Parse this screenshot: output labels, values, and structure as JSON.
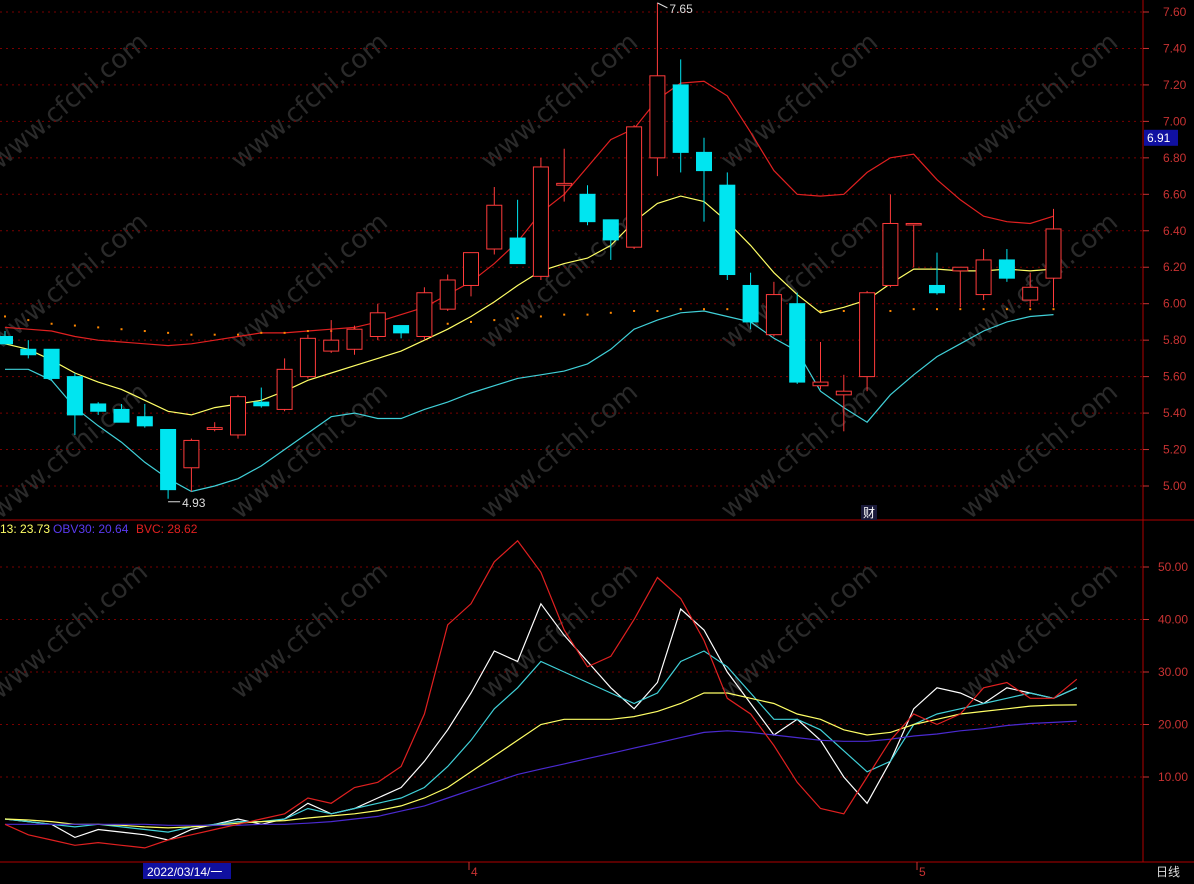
{
  "colors": {
    "background": "#000000",
    "frame": "#b00000",
    "grid": "#7a0000",
    "axis_text": "#c83232",
    "up": "#ff3b3b",
    "down": "#00e5f0",
    "ma_short": "#ffff66",
    "band_upper": "#e02020",
    "band_lower": "#40d0d8",
    "obv_white": "#ffffff",
    "obv_cyan": "#40d0d8",
    "obv_yellow": "#ffff66",
    "obv_blue": "#4a2ad0",
    "bvc_red": "#e02020",
    "price_tag_bg": "#1010a0",
    "date_tag_bg": "#1010a0"
  },
  "watermark": "www.cfchi.com",
  "chart_data": [
    {
      "type": "candlestick",
      "title": "",
      "ylim": [
        4.82,
        7.72
      ],
      "yticks": [
        "7.60",
        "7.40",
        "7.20",
        "7.00",
        "6.80",
        "6.60",
        "6.40",
        "6.20",
        "6.00",
        "5.80",
        "5.60",
        "5.40",
        "5.20",
        "5.00"
      ],
      "current_price_tag": "6.91",
      "high_label": "7.65",
      "low_label": "4.93",
      "event_marker": "财",
      "candles": [
        {
          "o": 5.82,
          "h": 5.85,
          "l": 5.78,
          "c": 5.78
        },
        {
          "o": 5.75,
          "h": 5.8,
          "l": 5.7,
          "c": 5.72
        },
        {
          "o": 5.75,
          "h": 5.75,
          "l": 5.58,
          "c": 5.59
        },
        {
          "o": 5.6,
          "h": 5.62,
          "l": 5.28,
          "c": 5.39
        },
        {
          "o": 5.45,
          "h": 5.46,
          "l": 5.39,
          "c": 5.41
        },
        {
          "o": 5.42,
          "h": 5.45,
          "l": 5.38,
          "c": 5.35
        },
        {
          "o": 5.38,
          "h": 5.45,
          "l": 5.32,
          "c": 5.33
        },
        {
          "o": 5.31,
          "h": 5.31,
          "l": 4.93,
          "c": 4.98
        },
        {
          "o": 5.1,
          "h": 5.26,
          "l": 4.97,
          "c": 5.25
        },
        {
          "o": 5.31,
          "h": 5.35,
          "l": 5.3,
          "c": 5.32
        },
        {
          "o": 5.28,
          "h": 5.5,
          "l": 5.26,
          "c": 5.49
        },
        {
          "o": 5.46,
          "h": 5.54,
          "l": 5.43,
          "c": 5.44
        },
        {
          "o": 5.42,
          "h": 5.7,
          "l": 5.41,
          "c": 5.64
        },
        {
          "o": 5.6,
          "h": 5.83,
          "l": 5.59,
          "c": 5.81
        },
        {
          "o": 5.74,
          "h": 5.91,
          "l": 5.73,
          "c": 5.8
        },
        {
          "o": 5.75,
          "h": 5.88,
          "l": 5.72,
          "c": 5.86
        },
        {
          "o": 5.82,
          "h": 6.0,
          "l": 5.8,
          "c": 5.95
        },
        {
          "o": 5.88,
          "h": 5.88,
          "l": 5.81,
          "c": 5.84
        },
        {
          "o": 5.82,
          "h": 6.09,
          "l": 5.8,
          "c": 6.06
        },
        {
          "o": 5.97,
          "h": 6.16,
          "l": 5.96,
          "c": 6.13
        },
        {
          "o": 6.1,
          "h": 6.23,
          "l": 6.04,
          "c": 6.28
        },
        {
          "o": 6.3,
          "h": 6.64,
          "l": 6.27,
          "c": 6.54
        },
        {
          "o": 6.36,
          "h": 6.57,
          "l": 6.22,
          "c": 6.22
        },
        {
          "o": 6.15,
          "h": 6.8,
          "l": 6.13,
          "c": 6.75
        },
        {
          "o": 6.65,
          "h": 6.85,
          "l": 6.56,
          "c": 6.66
        },
        {
          "o": 6.6,
          "h": 6.65,
          "l": 6.43,
          "c": 6.45
        },
        {
          "o": 6.46,
          "h": 6.46,
          "l": 6.24,
          "c": 6.35
        },
        {
          "o": 6.31,
          "h": 6.98,
          "l": 6.3,
          "c": 6.97
        },
        {
          "o": 6.8,
          "h": 7.65,
          "l": 6.7,
          "c": 7.25
        },
        {
          "o": 7.2,
          "h": 7.34,
          "l": 6.72,
          "c": 6.83
        },
        {
          "o": 6.83,
          "h": 6.91,
          "l": 6.45,
          "c": 6.73
        },
        {
          "o": 6.65,
          "h": 6.72,
          "l": 6.13,
          "c": 6.16
        },
        {
          "o": 6.1,
          "h": 6.17,
          "l": 5.86,
          "c": 5.9
        },
        {
          "o": 5.83,
          "h": 6.12,
          "l": 5.82,
          "c": 6.05
        },
        {
          "o": 6.0,
          "h": 6.06,
          "l": 5.56,
          "c": 5.57
        },
        {
          "o": 5.55,
          "h": 5.79,
          "l": 5.53,
          "c": 5.57
        },
        {
          "o": 5.5,
          "h": 5.61,
          "l": 5.3,
          "c": 5.52
        },
        {
          "o": 5.6,
          "h": 6.07,
          "l": 5.52,
          "c": 6.06
        },
        {
          "o": 6.1,
          "h": 6.6,
          "l": 6.09,
          "c": 6.44
        },
        {
          "o": 6.44,
          "h": 6.43,
          "l": 6.2,
          "c": 6.44
        },
        {
          "o": 6.1,
          "h": 6.28,
          "l": 6.05,
          "c": 6.06
        },
        {
          "o": 6.18,
          "h": 6.19,
          "l": 5.98,
          "c": 6.2
        },
        {
          "o": 6.05,
          "h": 6.3,
          "l": 6.02,
          "c": 6.24
        },
        {
          "o": 6.24,
          "h": 6.3,
          "l": 6.12,
          "c": 6.14
        },
        {
          "o": 6.02,
          "h": 6.17,
          "l": 5.98,
          "c": 6.09
        },
        {
          "o": 6.14,
          "h": 6.52,
          "l": 5.98,
          "c": 6.41
        }
      ],
      "series": [
        {
          "values": [
            5.87,
            5.86,
            5.85,
            5.82,
            5.8,
            5.79,
            5.78,
            5.77,
            5.78,
            5.8,
            5.82,
            5.84,
            5.84,
            5.85,
            5.86,
            5.87,
            5.9,
            5.94,
            5.98,
            6.05,
            6.12,
            6.22,
            6.34,
            6.5,
            6.6,
            6.75,
            6.9,
            6.96,
            7.12,
            7.21,
            7.22,
            7.14,
            6.94,
            6.73,
            6.6,
            6.59,
            6.6,
            6.72,
            6.8,
            6.82,
            6.68,
            6.57,
            6.48,
            6.45,
            6.44,
            6.48
          ]
        },
        {
          "values": [
            5.78,
            5.75,
            5.69,
            5.62,
            5.57,
            5.53,
            5.47,
            5.41,
            5.39,
            5.43,
            5.45,
            5.47,
            5.52,
            5.58,
            5.62,
            5.66,
            5.7,
            5.74,
            5.8,
            5.86,
            5.93,
            6.01,
            6.1,
            6.18,
            6.22,
            6.25,
            6.32,
            6.45,
            6.55,
            6.59,
            6.56,
            6.45,
            6.32,
            6.17,
            6.05,
            5.95,
            5.98,
            6.02,
            6.11,
            6.19,
            6.19,
            6.18,
            6.18,
            6.19,
            6.18,
            6.19
          ]
        },
        {
          "values": [
            5.64,
            5.64,
            5.58,
            5.43,
            5.33,
            5.24,
            5.13,
            5.04,
            4.97,
            5.0,
            5.04,
            5.11,
            5.2,
            5.29,
            5.38,
            5.4,
            5.37,
            5.37,
            5.42,
            5.46,
            5.51,
            5.55,
            5.59,
            5.61,
            5.63,
            5.67,
            5.75,
            5.86,
            5.91,
            5.95,
            5.96,
            5.93,
            5.9,
            5.81,
            5.74,
            5.52,
            5.43,
            5.35,
            5.5,
            5.61,
            5.71,
            5.78,
            5.85,
            5.9,
            5.93,
            5.94
          ]
        }
      ],
      "dot_series": {
        "values": [
          5.93,
          5.91,
          5.89,
          5.88,
          5.87,
          5.86,
          5.85,
          5.84,
          5.83,
          5.83,
          5.83,
          5.84,
          5.84,
          5.85,
          5.85,
          5.86,
          5.86,
          5.87,
          5.88,
          5.89,
          5.9,
          5.91,
          5.92,
          5.93,
          5.94,
          5.94,
          5.95,
          5.96,
          5.96,
          5.97,
          5.97,
          5.97,
          5.96,
          5.96,
          5.96,
          5.96,
          5.96,
          5.96,
          5.96,
          5.97,
          5.97,
          5.97,
          5.97,
          5.97,
          5.97,
          5.97
        ]
      }
    },
    {
      "type": "line",
      "title": "",
      "legend": [
        {
          "label": "13: 23.73",
          "color": "#ffff66"
        },
        {
          "label": "OBV30: 20.64",
          "color": "#4a2ad0"
        },
        {
          "label": "BVC: 28.62",
          "color": "#e02020"
        }
      ],
      "ylim": [
        -4,
        59
      ],
      "yticks": [
        "50.00",
        "40.00",
        "30.00",
        "20.00",
        "10.00"
      ],
      "x_labels": [
        "2022/03/14/一",
        "4",
        "5"
      ],
      "period_label": "日线",
      "series": [
        {
          "name": "",
          "values": [
            2,
            1.5,
            1,
            -1.5,
            0,
            -0.5,
            -1,
            -2,
            0,
            1,
            2,
            1,
            2,
            5,
            3,
            4,
            6,
            8,
            13,
            19,
            26,
            34,
            32,
            43,
            37,
            32,
            27,
            23,
            28,
            42,
            38,
            30,
            24,
            18,
            21,
            17,
            10,
            5,
            13,
            23,
            27,
            26,
            24,
            27,
            26,
            25,
            27
          ]
        },
        {
          "name": "",
          "values": [
            2,
            1.5,
            1,
            0.5,
            1,
            0.5,
            0,
            -0.5,
            0.5,
            1,
            1.5,
            1.5,
            2,
            4,
            3,
            4,
            5,
            6,
            8,
            12,
            17,
            23,
            27,
            32,
            30,
            28,
            26,
            24,
            26,
            32,
            34,
            31,
            26,
            21,
            21,
            19,
            15,
            11,
            13,
            20,
            22,
            23,
            24,
            25,
            26,
            25,
            27
          ]
        },
        {
          "name": "",
          "values": [
            2,
            1.8,
            1.5,
            1,
            1,
            0.8,
            0.5,
            0.3,
            0.5,
            0.8,
            1.2,
            1.5,
            1.7,
            2.2,
            2.6,
            3,
            3.6,
            4.5,
            6,
            8,
            11,
            14,
            17,
            20,
            21,
            21,
            21,
            21.5,
            22.5,
            24,
            26,
            26,
            25,
            24,
            22,
            21,
            19,
            18,
            18.5,
            20,
            21,
            22,
            22.5,
            23,
            23.5,
            23.7,
            23.73
          ]
        },
        {
          "name": "",
          "values": [
            1,
            1,
            1,
            1,
            1,
            1,
            1,
            0.8,
            0.8,
            0.8,
            0.8,
            1,
            1,
            1.2,
            1.5,
            2,
            2.5,
            3.5,
            4.5,
            6,
            7.5,
            9,
            10.5,
            11.5,
            12.5,
            13.5,
            14.5,
            15.5,
            16.5,
            17.5,
            18.5,
            18.8,
            18.5,
            18,
            17.5,
            17,
            16.8,
            16.8,
            17.2,
            17.8,
            18.2,
            18.8,
            19.2,
            19.8,
            20.2,
            20.4,
            20.64
          ]
        },
        {
          "name": "",
          "values": [
            1,
            -1,
            -2,
            -3,
            -2.5,
            -3,
            -3.5,
            -2,
            -1,
            0,
            1,
            2,
            3,
            6,
            5,
            8,
            9,
            12,
            22,
            39,
            43,
            51,
            55,
            49,
            38,
            31,
            33,
            40,
            48,
            44,
            36,
            25,
            22,
            16,
            9,
            4,
            3,
            10,
            17,
            22,
            20,
            22,
            27,
            28,
            25,
            25,
            28.62
          ]
        }
      ]
    }
  ]
}
